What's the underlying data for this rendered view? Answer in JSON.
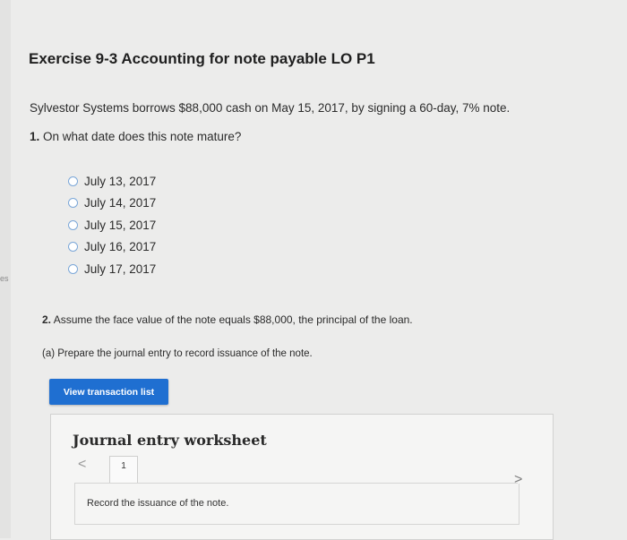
{
  "side": {
    "edge_text": "es"
  },
  "exercise": {
    "title": "Exercise 9-3 Accounting for note payable LO P1",
    "problem": "Sylvestor Systems borrows $88,000 cash on May 15, 2017, by signing a 60-day, 7% note."
  },
  "question1": {
    "number": "1.",
    "text": "On what date does this note mature?",
    "options": [
      "July 13, 2017",
      "July 14, 2017",
      "July 15, 2017",
      "July 16, 2017",
      "July 17, 2017"
    ]
  },
  "question2": {
    "number": "2.",
    "text": "Assume the face value of the note equals $88,000, the principal of the loan.",
    "part_a": "(a) Prepare the journal entry to record issuance of the note."
  },
  "actions": {
    "view_transaction_list": "View transaction list"
  },
  "worksheet": {
    "title": "Journal entry worksheet",
    "prev_icon": "<",
    "next_icon": ">",
    "tab_label": "1",
    "instruction": "Record the issuance of the note."
  },
  "colors": {
    "accent": "#1f6fd1",
    "radio_border": "#7ba7d8"
  }
}
